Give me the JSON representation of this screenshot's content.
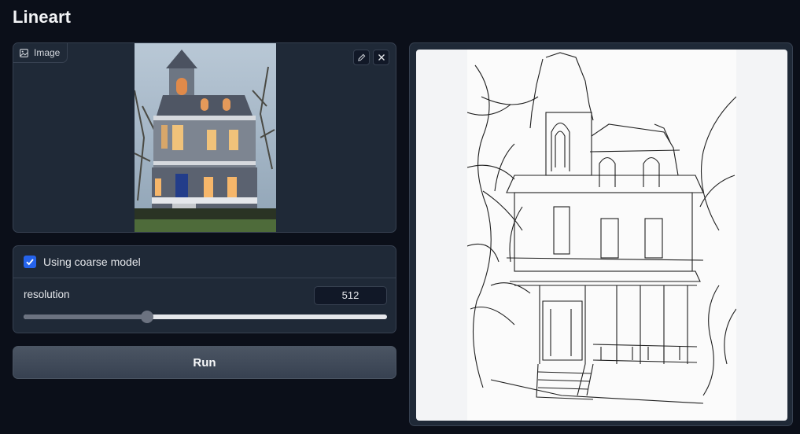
{
  "page": {
    "title": "Lineart"
  },
  "image_input": {
    "label": "Image",
    "icons": [
      "image-icon",
      "pencil-icon",
      "close-icon"
    ]
  },
  "settings": {
    "coarse_label": "Using coarse model",
    "coarse_checked": true,
    "resolution_label": "resolution",
    "resolution_value": "512",
    "resolution_fraction": 0.34
  },
  "run_label": "Run",
  "colors": {
    "background": "#0b0f19",
    "panel": "#1f2937",
    "border": "#374151",
    "accent": "#2563eb"
  }
}
